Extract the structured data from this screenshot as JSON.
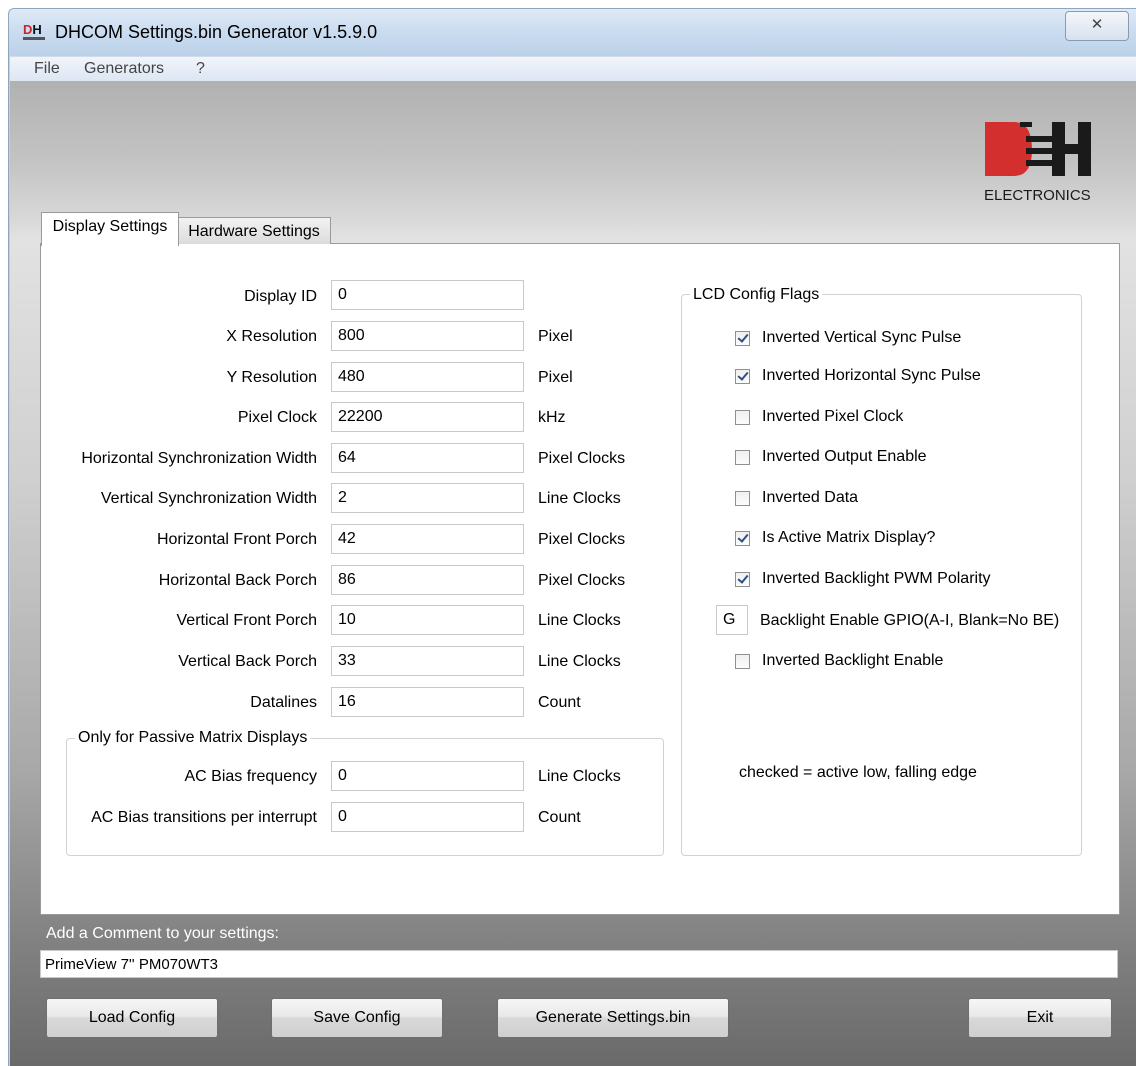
{
  "window": {
    "title": "DHCOM Settings.bin Generator v1.5.9.0",
    "close_glyph": "✕",
    "icon_text_d": "D",
    "icon_text_h": "H"
  },
  "menu": [
    "File",
    "Generators",
    "?"
  ],
  "logo": {
    "text": "ELECTRONICS",
    "brand_colors": {
      "red": "#d32f2f",
      "black": "#1a1a1a"
    }
  },
  "tabs": [
    {
      "label": "Display Settings",
      "active": true
    },
    {
      "label": "Hardware Settings",
      "active": false
    }
  ],
  "display_settings": {
    "fields": [
      {
        "label": "Display ID",
        "value": "0",
        "unit": ""
      },
      {
        "label": "X Resolution",
        "value": "800",
        "unit": "Pixel"
      },
      {
        "label": "Y Resolution",
        "value": "480",
        "unit": "Pixel"
      },
      {
        "label": "Pixel Clock",
        "value": "22200",
        "unit": "kHz"
      },
      {
        "label": "Horizontal Synchronization Width",
        "value": "64",
        "unit": "Pixel Clocks"
      },
      {
        "label": "Vertical Synchronization Width",
        "value": "2",
        "unit": "Line Clocks"
      },
      {
        "label": "Horizontal Front Porch",
        "value": "42",
        "unit": "Pixel Clocks"
      },
      {
        "label": "Horizontal Back Porch",
        "value": "86",
        "unit": "Pixel Clocks"
      },
      {
        "label": "Vertical Front Porch",
        "value": "10",
        "unit": "Line Clocks"
      },
      {
        "label": "Vertical Back Porch",
        "value": "33",
        "unit": "Line Clocks"
      },
      {
        "label": "Datalines",
        "value": "16",
        "unit": "Count"
      }
    ],
    "passive": {
      "title": "Only for Passive Matrix Displays",
      "fields": [
        {
          "label": "AC Bias frequency",
          "value": "0",
          "unit": "Line Clocks"
        },
        {
          "label": "AC Bias transitions per interrupt",
          "value": "0",
          "unit": "Count"
        }
      ]
    }
  },
  "lcd_flags": {
    "title": "LCD Config Flags",
    "items": [
      {
        "label": "Inverted Vertical Sync Pulse",
        "checked": true
      },
      {
        "label": "Inverted Horizontal Sync Pulse",
        "checked": true
      },
      {
        "label": "Inverted Pixel Clock",
        "checked": false
      },
      {
        "label": "Inverted Output Enable",
        "checked": false
      },
      {
        "label": "Inverted Data",
        "checked": false
      },
      {
        "label": "Is Active Matrix Display?",
        "checked": true
      },
      {
        "label": "Inverted Backlight PWM Polarity",
        "checked": true
      }
    ],
    "gpio": {
      "value": "G",
      "label": "Backlight Enable GPIO(A-I, Blank=No BE)"
    },
    "backlight_enable": {
      "label": "Inverted Backlight Enable",
      "checked": false
    },
    "note": "checked = active low, falling edge"
  },
  "comment": {
    "label": "Add a Comment to your settings:",
    "value": "PrimeView 7'' PM070WT3"
  },
  "buttons": {
    "load": "Load Config",
    "save": "Save Config",
    "generate": "Generate Settings.bin",
    "exit": "Exit"
  }
}
